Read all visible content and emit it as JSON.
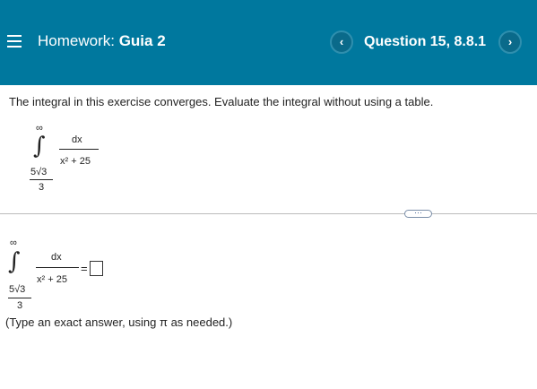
{
  "header": {
    "homework_label": "Homework:",
    "homework_name": "Guia 2",
    "prev_symbol": "‹",
    "question_label": "Question 15, 8.8.1",
    "next_symbol": "›"
  },
  "problem": {
    "prompt": "The integral in this exercise converges. Evaluate the integral without using a table.",
    "integral": {
      "upper_limit": "∞",
      "lower_limit_num": "5√3",
      "lower_limit_den": "3",
      "numerator": "dx",
      "denominator": "x² + 25"
    }
  },
  "more_button": "···",
  "answer": {
    "equals": "=",
    "value": "",
    "hint": "(Type an exact answer, using π as needed.)"
  }
}
